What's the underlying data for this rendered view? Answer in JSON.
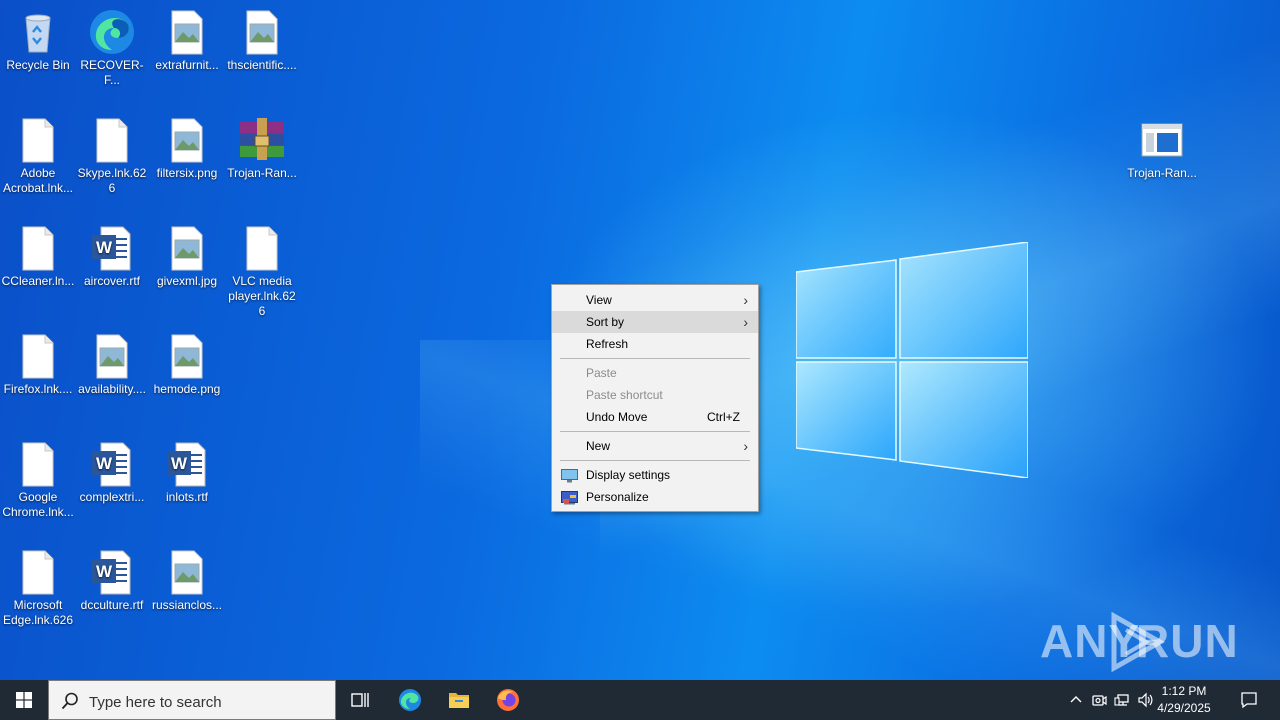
{
  "desktop": {
    "icons": [
      {
        "label": "Recycle Bin",
        "icon": "recycle-bin-icon"
      },
      {
        "label": "RECOVER-F...",
        "icon": "edge-icon"
      },
      {
        "label": "extrafurnit...",
        "icon": "image-file-icon"
      },
      {
        "label": "thscientific....",
        "icon": "image-file-icon"
      },
      {
        "label": "Adobe Acrobat.lnk...",
        "icon": "blank-file-icon"
      },
      {
        "label": "Skype.lnk.626",
        "icon": "blank-file-icon"
      },
      {
        "label": "filtersix.png",
        "icon": "image-file-icon"
      },
      {
        "label": "Trojan-Ran...",
        "icon": "winrar-archive-icon"
      },
      {
        "label": "CCleaner.ln...",
        "icon": "blank-file-icon"
      },
      {
        "label": "aircover.rtf",
        "icon": "word-document-icon"
      },
      {
        "label": "givexml.jpg",
        "icon": "image-file-icon"
      },
      {
        "label": "VLC media player.lnk.626",
        "icon": "blank-file-icon"
      },
      {
        "label": "Firefox.lnk....",
        "icon": "blank-file-icon"
      },
      {
        "label": "availability....",
        "icon": "image-file-icon"
      },
      {
        "label": "hemode.png",
        "icon": "image-file-icon"
      },
      {
        "label": "Google Chrome.lnk...",
        "icon": "blank-file-icon"
      },
      {
        "label": "complextri...",
        "icon": "word-document-icon"
      },
      {
        "label": "inlots.rtf",
        "icon": "word-document-icon"
      },
      {
        "label": "Microsoft Edge.lnk.626",
        "icon": "blank-file-icon"
      },
      {
        "label": "dcculture.rtf",
        "icon": "word-document-icon"
      },
      {
        "label": "russianclos...",
        "icon": "image-file-icon"
      },
      {
        "label": "Trojan-Ran...",
        "icon": "application-window-icon"
      }
    ]
  },
  "context_menu": {
    "view": "View",
    "sort_by": "Sort by",
    "refresh": "Refresh",
    "paste": "Paste",
    "paste_shortcut": "Paste shortcut",
    "undo_move": "Undo Move",
    "undo_shortcut": "Ctrl+Z",
    "new": "New",
    "display_settings": "Display settings",
    "personalize": "Personalize",
    "arrow": "›"
  },
  "watermark": {
    "left": "ANY",
    "right": "RUN"
  },
  "taskbar": {
    "search_placeholder": "Type here to search",
    "time": "1:12 PM",
    "date": "4/29/2025",
    "pinned": [
      "task-view-icon",
      "edge-icon",
      "file-explorer-icon",
      "firefox-icon"
    ]
  },
  "colors": {
    "desktop_blue": "#0a6fe2",
    "taskbar": "#202a35",
    "menu_bg": "#f2f2f2",
    "menu_hover": "#dadada"
  }
}
